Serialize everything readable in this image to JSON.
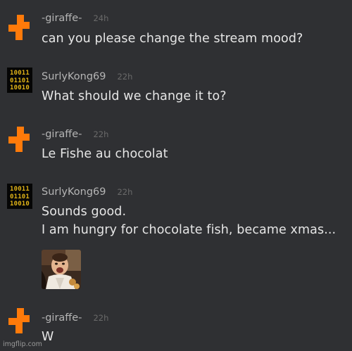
{
  "colors": {
    "background": "#2f3033",
    "username": "#b5b5b5",
    "timestamp": "#6a6a6a",
    "message_text": "#e6e6e6",
    "giraffe_avatar": "#ff7a0a",
    "binary_avatar_bg": "#050505",
    "binary_avatar_fg": "#e0b318"
  },
  "messages": [
    {
      "user": "-giraffe-",
      "time": "24h",
      "avatar": "giraffe-puzzle-icon",
      "lines": [
        "can you please change the stream mood?"
      ]
    },
    {
      "user": "SurlyKong69",
      "time": "22h",
      "avatar": "binary-code-avatar",
      "avatar_text": [
        "10011",
        "01101",
        "10010"
      ],
      "lines": [
        "What should we change it to?"
      ]
    },
    {
      "user": "-giraffe-",
      "time": "22h",
      "avatar": "giraffe-puzzle-icon",
      "lines": [
        "Le Fishe au chocolat"
      ]
    },
    {
      "user": "SurlyKong69",
      "time": "22h",
      "avatar": "binary-code-avatar",
      "avatar_text": [
        "10011",
        "01101",
        "10010"
      ],
      "lines": [
        "Sounds good.",
        "I am hungry for chocolate fish, became xmas..."
      ],
      "attachment": "reaction-image-thumbnail"
    },
    {
      "user": "-giraffe-",
      "time": "22h",
      "avatar": "giraffe-puzzle-icon",
      "lines": [
        "W"
      ]
    }
  ],
  "watermark": "imgflip.com"
}
